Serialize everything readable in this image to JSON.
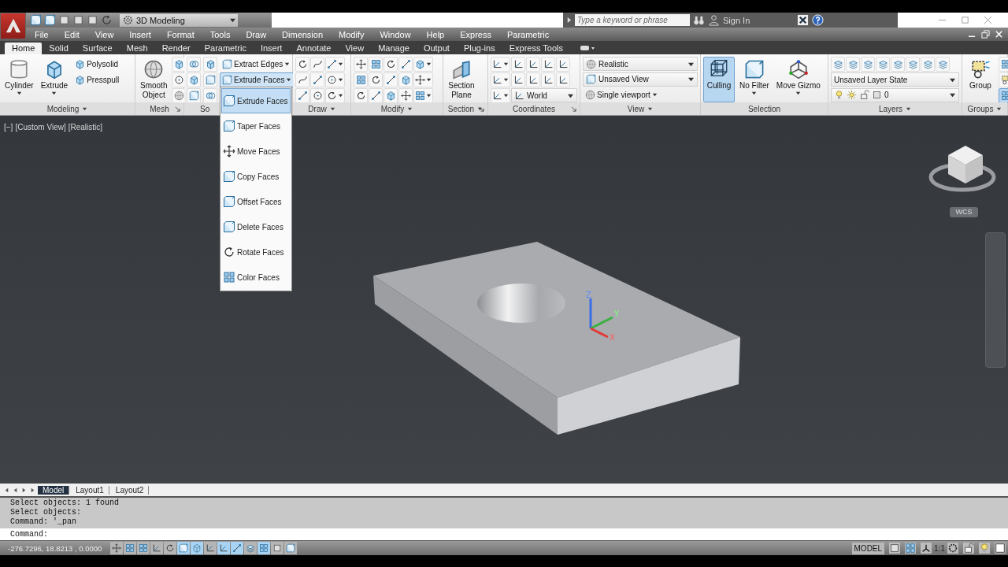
{
  "app": {
    "workspace": "3D Modeling",
    "search_placeholder": "Type a keyword or phrase",
    "sign_in": "Sign In"
  },
  "menu": [
    "File",
    "Edit",
    "View",
    "Insert",
    "Format",
    "Tools",
    "Draw",
    "Dimension",
    "Modify",
    "Window",
    "Help",
    "Express",
    "Parametric"
  ],
  "ribbon_tabs": [
    {
      "label": "Home",
      "selected": true
    },
    {
      "label": "Solid",
      "selected": false
    },
    {
      "label": "Surface",
      "selected": false
    },
    {
      "label": "Mesh",
      "selected": false
    },
    {
      "label": "Render",
      "selected": false
    },
    {
      "label": "Parametric",
      "selected": false
    },
    {
      "label": "Insert",
      "selected": false
    },
    {
      "label": "Annotate",
      "selected": false
    },
    {
      "label": "View",
      "selected": false
    },
    {
      "label": "Manage",
      "selected": false
    },
    {
      "label": "Output",
      "selected": false
    },
    {
      "label": "Plug-ins",
      "selected": false
    },
    {
      "label": "Express Tools",
      "selected": false
    }
  ],
  "ribbon_panels": [
    {
      "title": "Modeling",
      "caret": true,
      "launcher": false,
      "groups": [
        [
          {
            "kind": "large",
            "lines": [
              "Cylinder"
            ],
            "caret": true
          }
        ],
        [
          {
            "kind": "large",
            "lines": [
              "Extrude"
            ],
            "caret": true
          }
        ],
        [
          {
            "kind": "small",
            "label": "Polysolid",
            "caret": false
          },
          {
            "kind": "small",
            "label": "Presspull",
            "caret": false
          }
        ]
      ]
    },
    {
      "title": "Mesh",
      "caret": false,
      "launcher": true,
      "groups": [
        [
          {
            "kind": "large",
            "lines": [
              "Smooth",
              "Object"
            ],
            "caret": false
          }
        ],
        [
          {
            "kind": "icon",
            "caret": false
          },
          {
            "kind": "icon",
            "caret": false
          },
          {
            "kind": "icon",
            "caret": false
          }
        ]
      ]
    },
    {
      "title": "So",
      "caret": false,
      "launcher": false,
      "groups": [
        [
          {
            "kind": "icon",
            "caret": false
          },
          {
            "kind": "icon",
            "caret": false
          },
          {
            "kind": "icon",
            "caret": false
          }
        ],
        [
          {
            "kind": "icon",
            "caret": false
          },
          {
            "kind": "icon",
            "caret": false
          },
          {
            "kind": "icon",
            "caret": false
          }
        ],
        [
          {
            "kind": "small",
            "label": "Extract Edges",
            "caret": true
          },
          {
            "kind": "split",
            "label": "Extrude Faces",
            "on": true
          }
        ]
      ]
    },
    {
      "title": "Draw",
      "caret": true,
      "launcher": false,
      "groups": [
        [
          {
            "kind": "icon",
            "caret": false
          },
          {
            "kind": "icon",
            "caret": false
          },
          {
            "kind": "icon",
            "caret": true
          }
        ],
        [
          {
            "kind": "icon",
            "caret": false
          },
          {
            "kind": "icon",
            "caret": false
          },
          {
            "kind": "icon",
            "caret": true
          }
        ],
        [
          {
            "kind": "icon",
            "caret": false
          },
          {
            "kind": "icon",
            "caret": false
          },
          {
            "kind": "icon",
            "caret": true
          }
        ]
      ]
    },
    {
      "title": "Modify",
      "caret": true,
      "launcher": false,
      "groups": [
        [
          {
            "kind": "icon",
            "caret": false
          },
          {
            "kind": "icon",
            "caret": false
          },
          {
            "kind": "icon",
            "caret": false
          },
          {
            "kind": "icon",
            "caret": false
          },
          {
            "kind": "icon",
            "caret": true
          }
        ],
        [
          {
            "kind": "icon",
            "caret": false
          },
          {
            "kind": "icon",
            "caret": false
          },
          {
            "kind": "icon",
            "caret": false
          },
          {
            "kind": "icon",
            "caret": false
          },
          {
            "kind": "icon",
            "caret": true
          }
        ],
        [
          {
            "kind": "icon",
            "caret": false
          },
          {
            "kind": "icon",
            "caret": false
          },
          {
            "kind": "icon",
            "caret": false
          },
          {
            "kind": "icon",
            "caret": false
          },
          {
            "kind": "icon",
            "caret": true
          }
        ]
      ]
    },
    {
      "title": "Section",
      "caret": true,
      "launcher": true,
      "groups": [
        [
          {
            "kind": "large",
            "lines": [
              "Section",
              "Plane"
            ],
            "caret": false
          }
        ]
      ]
    },
    {
      "title": "Coordinates",
      "caret": false,
      "launcher": true,
      "groups": [
        [
          {
            "kind": "icon",
            "caret": true
          },
          {
            "kind": "icon",
            "caret": false
          },
          {
            "kind": "icon",
            "caret": false
          },
          {
            "kind": "icon",
            "caret": false
          },
          {
            "kind": "icon",
            "caret": false
          }
        ],
        [
          {
            "kind": "icon",
            "caret": true
          },
          {
            "kind": "icon",
            "caret": false
          },
          {
            "kind": "icon",
            "caret": false
          },
          {
            "kind": "icon",
            "caret": false
          },
          {
            "kind": "icon",
            "caret": false
          }
        ],
        [
          {
            "kind": "icon",
            "caret": true
          },
          {
            "kind": "icon-combo",
            "label": "World"
          }
        ]
      ]
    },
    {
      "title": "View",
      "caret": true,
      "launcher": false,
      "groups": [
        [
          {
            "kind": "icon-combo",
            "label": "Realistic"
          }
        ],
        [
          {
            "kind": "icon-combo",
            "label": "Unsaved View"
          }
        ],
        [
          {
            "kind": "small",
            "label": "Single viewport",
            "caret": true
          }
        ]
      ]
    },
    {
      "title": "Selection",
      "caret": false,
      "launcher": false,
      "groups": [
        [
          {
            "kind": "large",
            "lines": [
              "Culling"
            ],
            "caret": false,
            "on": true
          }
        ],
        [
          {
            "kind": "large",
            "lines": [
              "No Filter"
            ],
            "caret": true,
            "on": false
          }
        ],
        [
          {
            "kind": "large",
            "lines": [
              "Move Gizmo"
            ],
            "caret": true,
            "on": false
          }
        ]
      ]
    },
    {
      "title": "Layers",
      "caret": true,
      "launcher": false,
      "groups": [
        [
          {
            "kind": "icon",
            "caret": false
          },
          {
            "kind": "icon",
            "caret": false
          },
          {
            "kind": "icon",
            "caret": false
          },
          {
            "kind": "icon",
            "caret": false
          },
          {
            "kind": "icon",
            "caret": false
          },
          {
            "kind": "icon",
            "caret": false
          },
          {
            "kind": "icon",
            "caret": false
          },
          {
            "kind": "icon",
            "caret": false
          }
        ],
        [
          {
            "kind": "combo",
            "label": "Unsaved Layer State"
          }
        ],
        [
          {
            "kind": "layer-combo",
            "label": "0"
          }
        ]
      ]
    },
    {
      "title": "Groups",
      "caret": true,
      "launcher": false,
      "groups": [
        [
          {
            "kind": "large",
            "lines": [
              "Group"
            ],
            "caret": false,
            "on": false
          }
        ],
        [
          {
            "kind": "icon",
            "caret": false,
            "on": false
          },
          {
            "kind": "icon",
            "caret": false,
            "on": false
          },
          {
            "kind": "icon",
            "caret": false,
            "on": true
          }
        ]
      ]
    }
  ],
  "face_menu": [
    {
      "label": "Extrude Faces",
      "selected": true
    },
    {
      "label": "Taper Faces",
      "selected": false
    },
    {
      "label": "Move Faces",
      "selected": false
    },
    {
      "label": "Copy Faces",
      "selected": false
    },
    {
      "label": "Offset Faces",
      "selected": false
    },
    {
      "label": "Delete Faces",
      "selected": false
    },
    {
      "label": "Rotate Faces",
      "selected": false
    },
    {
      "label": "Color Faces",
      "selected": false
    }
  ],
  "viewport": {
    "controls": [
      "[−]",
      "[Custom View]",
      "[Realistic]"
    ],
    "ucs_labels": [
      "Z",
      "Y",
      "X"
    ],
    "wcs": "WCS"
  },
  "layout_tabs": [
    {
      "label": "Model",
      "selected": true
    },
    {
      "label": "Layout1",
      "selected": false
    },
    {
      "label": "Layout2",
      "selected": false
    }
  ],
  "command_history": [
    "Select objects: 1 found",
    "Select objects:",
    "Command: '_pan"
  ],
  "command_prompt": "Command:",
  "status": {
    "coordinates": "-276.7296, 18.8213 , 0.0000",
    "toggles": [
      {
        "on": false
      },
      {
        "on": false
      },
      {
        "on": false
      },
      {
        "on": false
      },
      {
        "on": false
      },
      {
        "on": true
      },
      {
        "on": true
      },
      {
        "on": false
      },
      {
        "on": true
      },
      {
        "on": true
      },
      {
        "on": false
      },
      {
        "on": true
      },
      {
        "on": false
      },
      {
        "on": false
      }
    ],
    "space": "MODEL",
    "scale": "1:1"
  }
}
